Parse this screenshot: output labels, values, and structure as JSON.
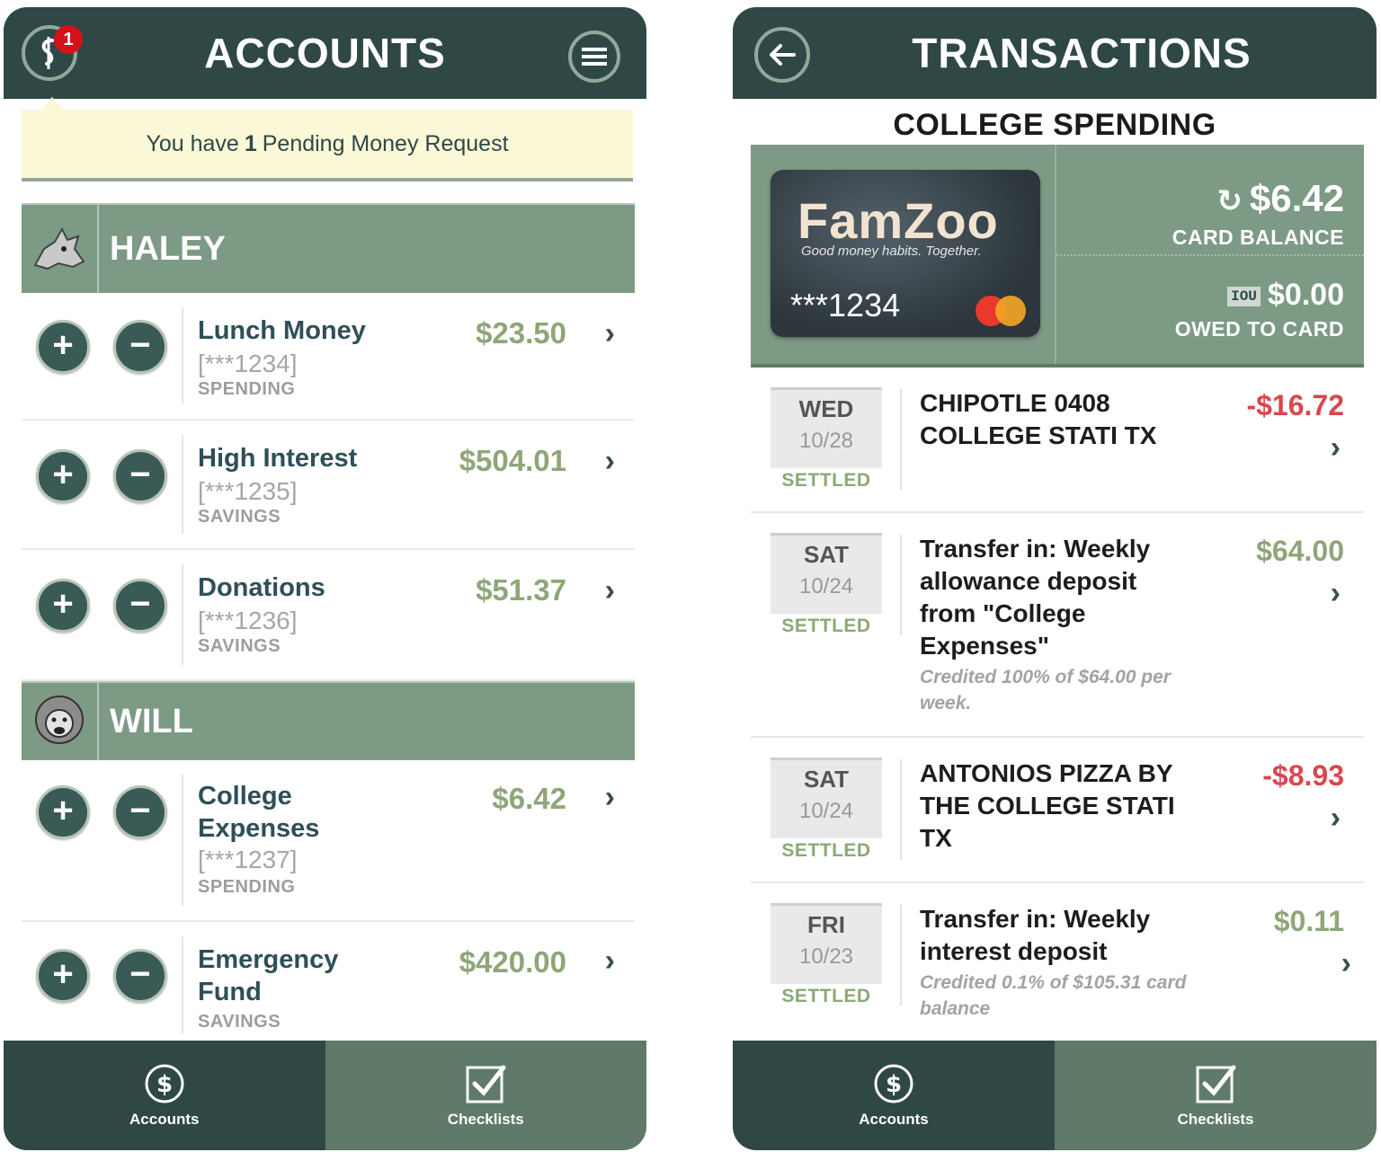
{
  "left": {
    "title": "ACCOUNTS",
    "notification_count": "1",
    "pending": {
      "prefix": "You have",
      "count": "1",
      "suffix": "Pending Money Request"
    },
    "people": [
      {
        "name": "HALEY",
        "accounts": [
          {
            "name": "Lunch Money",
            "number": "[***1234]",
            "type": "SPENDING",
            "amount": "$23.50"
          },
          {
            "name": "High Interest",
            "number": "[***1235]",
            "type": "SAVINGS",
            "amount": "$504.01"
          },
          {
            "name": "Donations",
            "number": "[***1236]",
            "type": "SAVINGS",
            "amount": "$51.37"
          }
        ]
      },
      {
        "name": "WILL",
        "accounts": [
          {
            "name_line1": "College",
            "name_line2": "Expenses",
            "number": "[***1237]",
            "type": "SPENDING",
            "amount": "$6.42"
          },
          {
            "name_line1": "Emergency",
            "name_line2": "Fund",
            "type": "SAVINGS",
            "amount": "$420.00"
          }
        ]
      }
    ],
    "tabs": [
      {
        "label": "Accounts",
        "icon": "dollar-circle-icon"
      },
      {
        "label": "Checklists",
        "icon": "checkbox-icon"
      }
    ]
  },
  "right": {
    "title": "TRANSACTIONS",
    "subtitle": "COLLEGE SPENDING",
    "card": {
      "brand": "FamZoo",
      "tagline": "Good money habits. Together.",
      "number": "***1234"
    },
    "card_balance": {
      "amount": "$6.42",
      "label": "CARD BALANCE"
    },
    "owed": {
      "badge": "IOU",
      "amount": "$0.00",
      "label": "OWED TO CARD"
    },
    "transactions": [
      {
        "dow": "WED",
        "date": "10/28",
        "status": "SETTLED",
        "line1": "CHIPOTLE 0408",
        "line2": "COLLEGE STATI TX",
        "amount": "-$16.72"
      },
      {
        "dow": "SAT",
        "date": "10/24",
        "status": "SETTLED",
        "line1": "Transfer in: Weekly",
        "line2": "allowance deposit",
        "line3": "from \"College",
        "line4": "Expenses\"",
        "note1": "Credited 100% of $64.00 per",
        "note2": "week.",
        "amount": "$64.00"
      },
      {
        "dow": "SAT",
        "date": "10/24",
        "status": "SETTLED",
        "line1": "ANTONIOS PIZZA BY",
        "line2": "THE COLLEGE STATI",
        "line3": "TX",
        "amount": "-$8.93"
      },
      {
        "dow": "FRI",
        "date": "10/23",
        "status": "SETTLED",
        "line1": "Transfer in: Weekly",
        "line2": "interest deposit",
        "note1": "Credited 0.1% of $105.31 card",
        "note2": "balance",
        "amount": "$0.11"
      }
    ],
    "tabs": [
      {
        "label": "Accounts",
        "icon": "dollar-circle-icon"
      },
      {
        "label": "Checklists",
        "icon": "checkbox-icon"
      }
    ]
  },
  "colors": {
    "header": "#2f4845",
    "section": "#7d9a85",
    "positive": "#8ea678",
    "negative": "#d9474f",
    "banner": "#fbf8d8"
  }
}
